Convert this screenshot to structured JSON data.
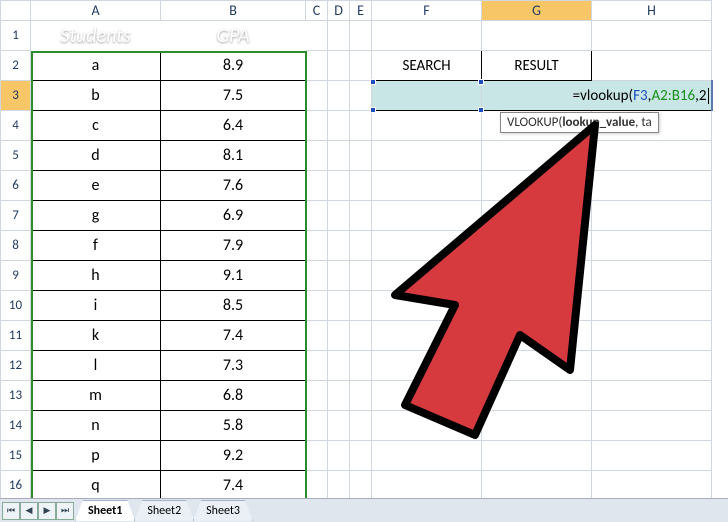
{
  "columns": [
    "A",
    "B",
    "C",
    "D",
    "E",
    "F",
    "G",
    "H"
  ],
  "active_column": "G",
  "active_row": 3,
  "table": {
    "headers": {
      "students": "Students",
      "gpa": "GPA"
    },
    "rows": [
      {
        "s": "a",
        "g": "8.9"
      },
      {
        "s": "b",
        "g": "7.5"
      },
      {
        "s": "c",
        "g": "6.4"
      },
      {
        "s": "d",
        "g": "8.1"
      },
      {
        "s": "e",
        "g": "7.6"
      },
      {
        "s": "g",
        "g": "6.9"
      },
      {
        "s": "f",
        "g": "7.9"
      },
      {
        "s": "h",
        "g": "9.1"
      },
      {
        "s": "i",
        "g": "8.5"
      },
      {
        "s": "k",
        "g": "7.4"
      },
      {
        "s": "l",
        "g": "7.3"
      },
      {
        "s": "m",
        "g": "6.8"
      },
      {
        "s": "n",
        "g": "5.8"
      },
      {
        "s": "p",
        "g": "9.2"
      },
      {
        "s": "q",
        "g": "7.4"
      }
    ]
  },
  "labels": {
    "search": "SEARCH",
    "result": "RESULT"
  },
  "formula": {
    "prefix": "=vlookup(",
    "ref1": "F3",
    "sep1": ",",
    "ref2": "A2:B16",
    "sep2": ",",
    "arg3": "2"
  },
  "tooltip": {
    "fn": "VLOOKUP",
    "sig_prefix": "(",
    "arg_bold": "lookup_value",
    "sig_rest": ", ta"
  },
  "tabs": {
    "t1": "Sheet1",
    "t2": "Sheet2",
    "t3": "Sheet3",
    "active": "Sheet1"
  },
  "nav": {
    "first": "⏮",
    "prev": "◀",
    "next": "▶",
    "last": "⏭"
  }
}
